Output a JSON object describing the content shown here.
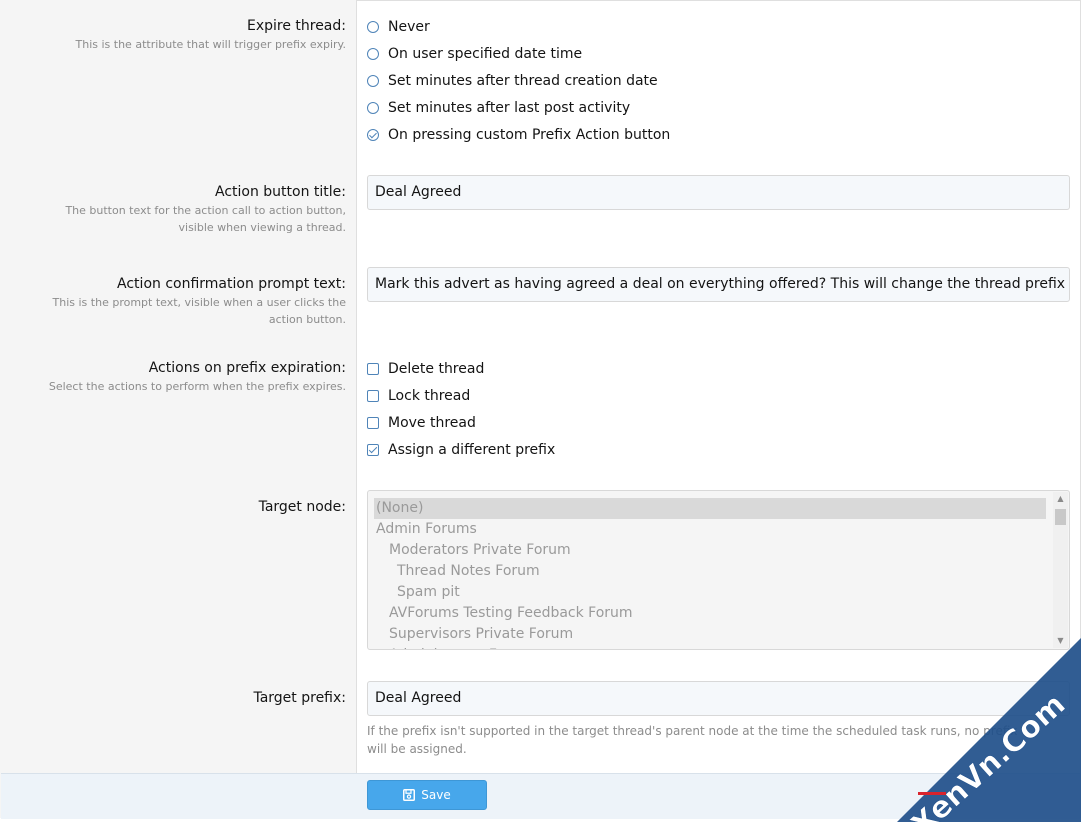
{
  "expire": {
    "label": "Expire thread:",
    "hint": "This is the attribute that will trigger prefix expiry.",
    "options": [
      {
        "label": "Never",
        "checked": false
      },
      {
        "label": "On user specified date time",
        "checked": false
      },
      {
        "label": "Set minutes after thread creation date",
        "checked": false
      },
      {
        "label": "Set minutes after last post activity",
        "checked": false
      },
      {
        "label": "On pressing custom Prefix Action button",
        "checked": true
      }
    ]
  },
  "action_title": {
    "label": "Action button title:",
    "hint": "The button text for the action call to action button, visible when viewing a thread.",
    "value": "Deal Agreed"
  },
  "action_prompt": {
    "label": "Action confirmation prompt text:",
    "hint": "This is the prompt text, visible when a user clicks the action button.",
    "value": "Mark this advert as having agreed a deal on everything offered?  This will change the thread prefix to let"
  },
  "actions": {
    "label": "Actions on prefix expiration:",
    "hint": "Select the actions to perform when the prefix expires.",
    "options": [
      {
        "label": "Delete thread",
        "checked": false
      },
      {
        "label": "Lock thread",
        "checked": false
      },
      {
        "label": "Move thread",
        "checked": false
      },
      {
        "label": "Assign a different prefix",
        "checked": true
      }
    ]
  },
  "target_node": {
    "label": "Target node:",
    "items": [
      {
        "label": "(None)",
        "level": 0,
        "selected": true
      },
      {
        "label": "Admin Forums",
        "level": 0,
        "selected": false
      },
      {
        "label": "Moderators Private Forum",
        "level": 1,
        "selected": false
      },
      {
        "label": "Thread Notes Forum",
        "level": 2,
        "selected": false
      },
      {
        "label": "Spam pit",
        "level": 2,
        "selected": false
      },
      {
        "label": "AVForums Testing Feedback Forum",
        "level": 1,
        "selected": false
      },
      {
        "label": "Supervisors Private Forum",
        "level": 1,
        "selected": false
      },
      {
        "label": "Administrator Forums",
        "level": 1,
        "selected": false
      }
    ]
  },
  "target_prefix": {
    "label": "Target prefix:",
    "value": "Deal Agreed",
    "note": "If the prefix isn't supported in the target thread's parent node at the time the scheduled task runs, no prefix will be assigned."
  },
  "footer": {
    "save_label": "Save"
  },
  "watermark": {
    "text": "XenVn.Com"
  },
  "colors": {
    "accent": "#47a7eb",
    "control_border": "#4f84b8",
    "watermark": "#1f4f8a"
  }
}
